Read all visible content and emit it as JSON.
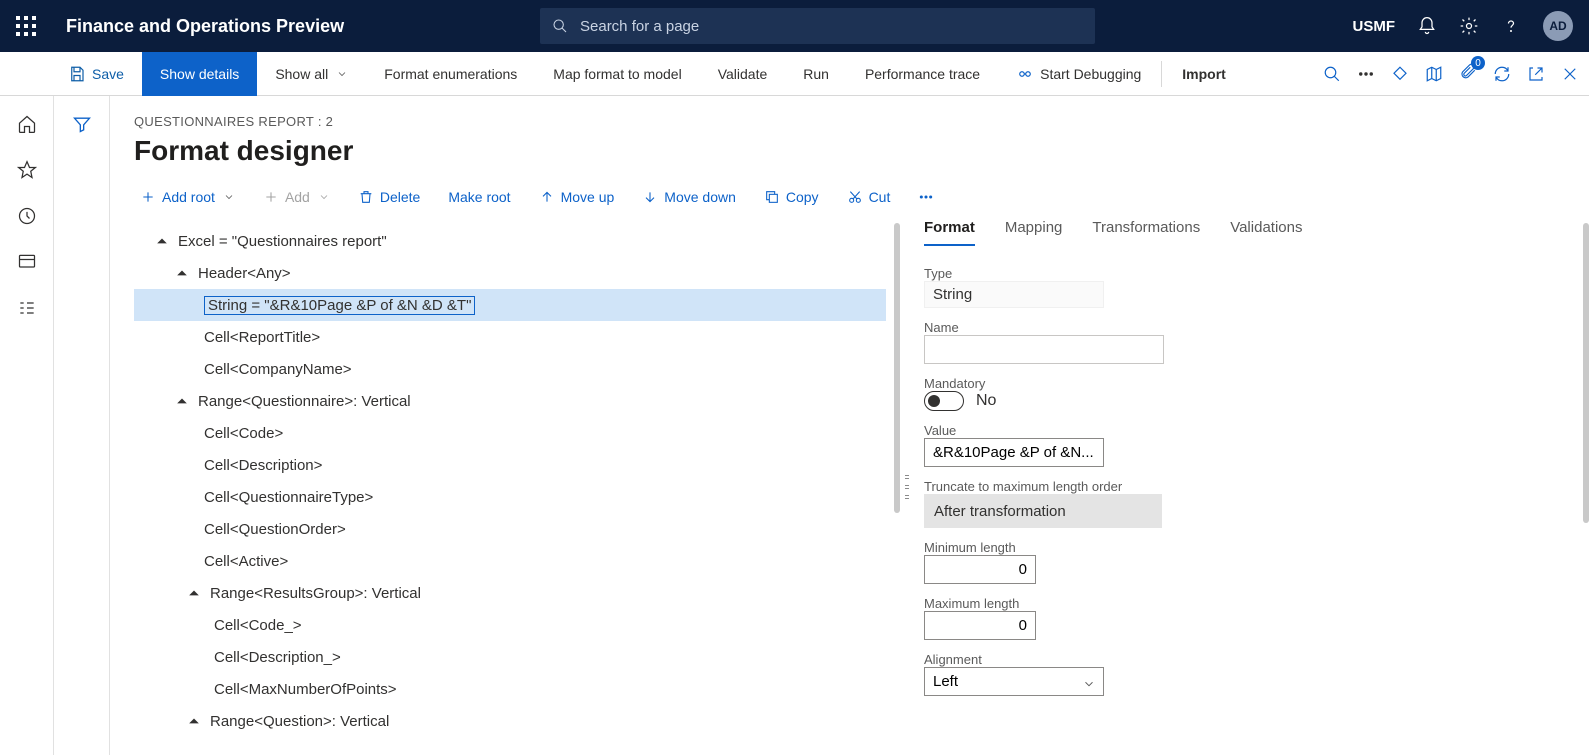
{
  "title_bar": {
    "app_title": "Finance and Operations Preview",
    "search_placeholder": "Search for a page",
    "company": "USMF",
    "avatar": "AD"
  },
  "action_bar": {
    "save": "Save",
    "show_details": "Show details",
    "show_all": "Show all",
    "format_enum": "Format enumerations",
    "map": "Map format to model",
    "validate": "Validate",
    "run": "Run",
    "perf": "Performance trace",
    "debug": "Start Debugging",
    "import": "Import",
    "badge": "0"
  },
  "page": {
    "crumb": "QUESTIONNAIRES REPORT : 2",
    "title": "Format designer"
  },
  "toolbar": {
    "add_root": "Add root",
    "add": "Add",
    "delete": "Delete",
    "make_root": "Make root",
    "move_up": "Move up",
    "move_down": "Move down",
    "copy": "Copy",
    "cut": "Cut"
  },
  "tree": {
    "n0": "Excel = \"Questionnaires report\"",
    "n1": "Header<Any>",
    "n1a": "String = \"&R&10Page &P of &N &D &T\"",
    "n1b": "Cell<ReportTitle>",
    "n1c": "Cell<CompanyName>",
    "n2": "Range<Questionnaire>: Vertical",
    "n2a": "Cell<Code>",
    "n2b": "Cell<Description>",
    "n2c": "Cell<QuestionnaireType>",
    "n2d": "Cell<QuestionOrder>",
    "n2e": "Cell<Active>",
    "n3": "Range<ResultsGroup>: Vertical",
    "n3a": "Cell<Code_>",
    "n3b": "Cell<Description_>",
    "n3c": "Cell<MaxNumberOfPoints>",
    "n4": "Range<Question>: Vertical"
  },
  "tabs": {
    "format": "Format",
    "mapping": "Mapping",
    "transformations": "Transformations",
    "validations": "Validations"
  },
  "props": {
    "type_label": "Type",
    "type_value": "String",
    "name_label": "Name",
    "name_value": "",
    "mandatory_label": "Mandatory",
    "mandatory_text": "No",
    "value_label": "Value",
    "value_value": "&R&10Page &P of &N...",
    "truncate_label": "Truncate to maximum length order",
    "truncate_value": "After transformation",
    "min_label": "Minimum length",
    "min_value": "0",
    "max_label": "Maximum length",
    "max_value": "0",
    "align_label": "Alignment",
    "align_value": "Left"
  }
}
